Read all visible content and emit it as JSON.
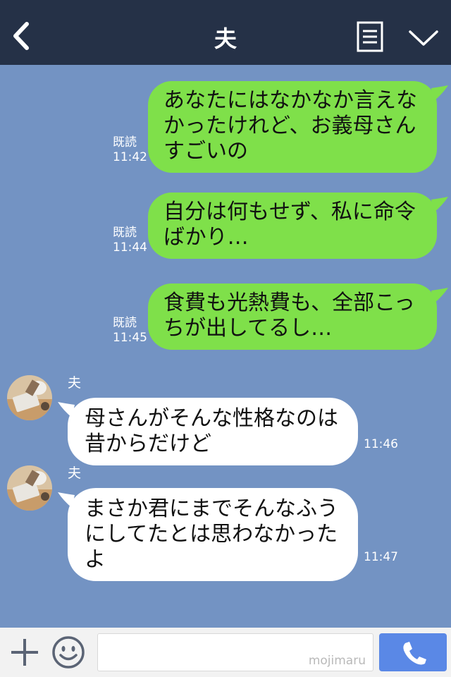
{
  "header": {
    "title": "夫"
  },
  "messages": {
    "outgoing": [
      {
        "read": "既読",
        "time": "11:42",
        "lines": [
          "あなたにはなかなか言えな",
          "かったけれど、お義母さん",
          "すごいの"
        ]
      },
      {
        "read": "既読",
        "time": "11:44",
        "lines": [
          "自分は何もせず、私に命令",
          "ばかり…"
        ]
      },
      {
        "read": "既読",
        "time": "11:45",
        "lines": [
          "食費も光熱費も、全部こっ",
          "ちが出してるし…"
        ]
      }
    ],
    "incoming": [
      {
        "sender": "夫",
        "time": "11:46",
        "lines": [
          "母さんがそんな性格なのは",
          "昔からだけど"
        ]
      },
      {
        "sender": "夫",
        "time": "11:47",
        "lines": [
          "まさか君にまでそんなふう",
          "にしてたとは思わなかった",
          "よ"
        ]
      }
    ]
  },
  "input": {
    "watermark": "mojimaru"
  },
  "icons": {
    "back": "chevron-left-icon",
    "menu": "notes-icon",
    "dropdown": "chevron-down-icon",
    "plus": "plus-icon",
    "emoji": "smiley-icon",
    "call": "phone-icon"
  },
  "colors": {
    "header": "#253147",
    "background": "#7393c3",
    "outgoing_bubble": "#7fe04a",
    "incoming_bubble": "#ffffff",
    "call_button": "#5a88e6"
  }
}
